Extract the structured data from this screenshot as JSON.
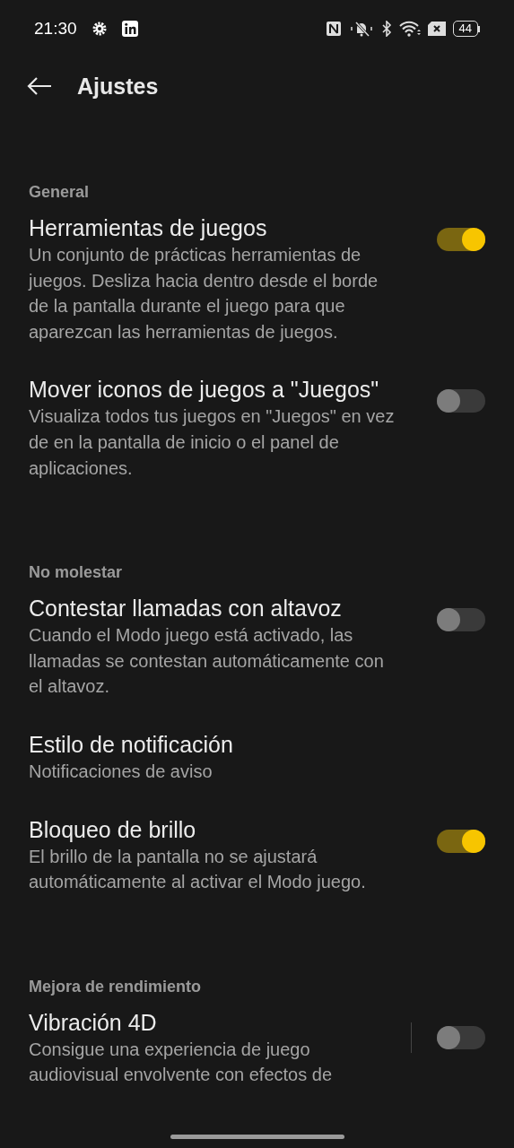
{
  "status_bar": {
    "time": "21:30",
    "battery": "44"
  },
  "header": {
    "title": "Ajustes"
  },
  "sections": [
    {
      "title": "General",
      "items": [
        {
          "kind": "toggle",
          "title": "Herramientas de juegos",
          "description": "Un conjunto de prácticas herramientas de juegos. Desliza hacia dentro desde el borde de la pantalla durante el juego para que aparezcan las herramientas de juegos.",
          "on": true,
          "separator": false
        },
        {
          "kind": "toggle",
          "title": "Mover iconos de juegos a \"Juegos\"",
          "description": "Visualiza todos tus juegos en \"Juegos\" en vez de en la pantalla de inicio o el panel de aplicaciones.",
          "on": false,
          "separator": false
        }
      ]
    },
    {
      "title": "No molestar",
      "items": [
        {
          "kind": "toggle",
          "title": "Contestar llamadas con altavoz",
          "description": "Cuando el Modo juego está activado, las llamadas se contestan automáticamente con el altavoz.",
          "on": false,
          "separator": false
        },
        {
          "kind": "link",
          "title": "Estilo de notificación",
          "description": "Notificaciones de aviso"
        },
        {
          "kind": "toggle",
          "title": "Bloqueo de brillo",
          "description": "El brillo de la pantalla no se ajustará automáticamente al activar el Modo juego.",
          "on": true,
          "separator": false
        }
      ]
    },
    {
      "title": "Mejora de rendimiento",
      "items": [
        {
          "kind": "toggle",
          "title": "Vibración 4D",
          "description": "Consigue una experiencia de juego audiovisual envolvente con efectos de",
          "on": false,
          "separator": true
        }
      ]
    }
  ]
}
